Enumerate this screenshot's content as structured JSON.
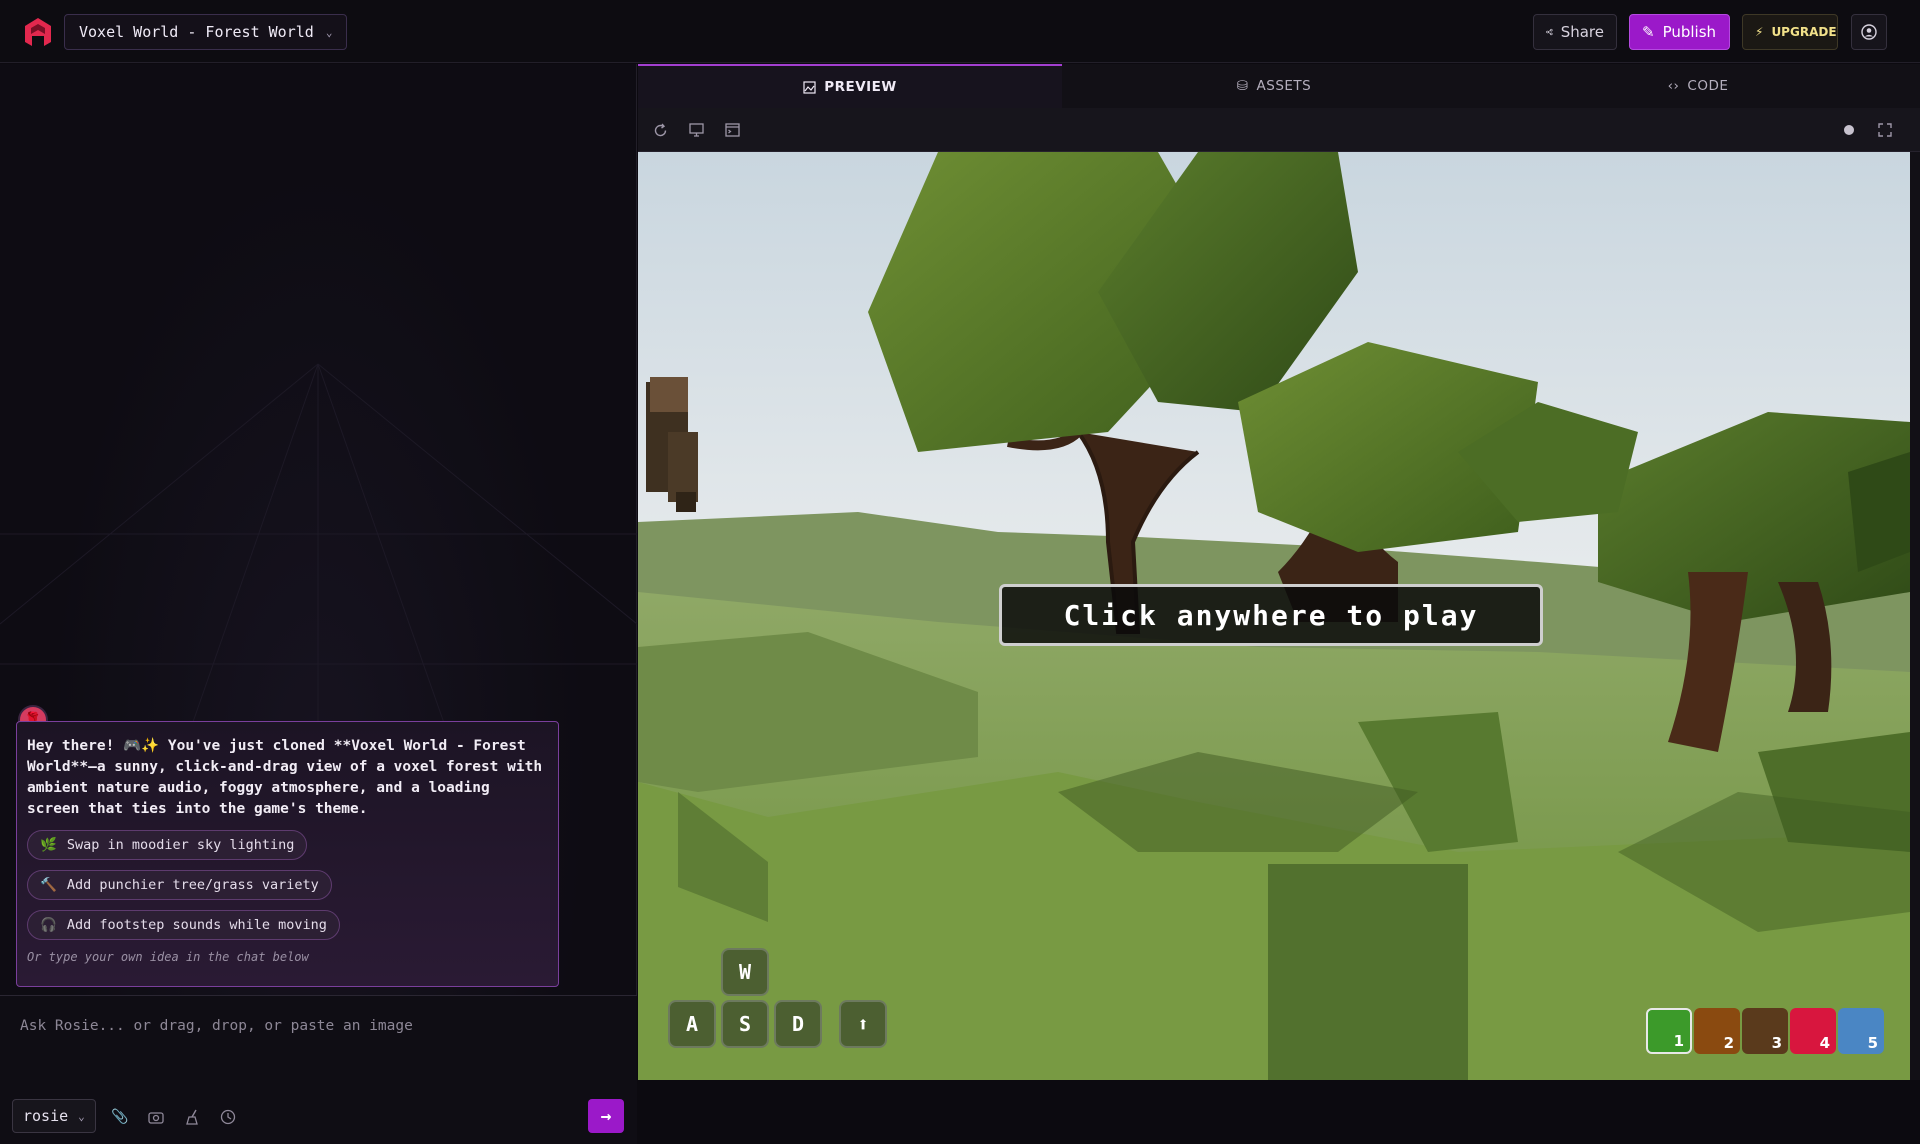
{
  "header": {
    "project_title": "Voxel World - Forest World",
    "share_label": "Share",
    "publish_label": "Publish",
    "upgrade_label": "UPGRADE"
  },
  "chat": {
    "message": "Hey there! 🎮✨ You've just cloned **Voxel World - Forest World**—a sunny, click-and-drag view of a voxel forest with ambient nature audio, foggy atmosphere, and a loading screen that ties into the game's theme.",
    "suggestions": [
      {
        "icon": "🌿",
        "label": "Swap in moodier sky lighting"
      },
      {
        "icon": "🔨",
        "label": "Add punchier tree/grass variety"
      },
      {
        "icon": "🎧",
        "label": "Add footstep sounds while moving"
      }
    ],
    "hint": "Or type your own idea in the chat below",
    "input_placeholder": "Ask Rosie... or drag, drop, or paste an image",
    "model": "rosie"
  },
  "tabs": [
    {
      "label": "PREVIEW"
    },
    {
      "label": "ASSETS"
    },
    {
      "label": "CODE"
    }
  ],
  "game": {
    "overlay_text": "Click anywhere to play",
    "keys": [
      "W",
      "A",
      "S",
      "D",
      "⬆"
    ],
    "hotbar": [
      {
        "num": "1",
        "color": "#3c9a2a"
      },
      {
        "num": "2",
        "color": "#8a4a10"
      },
      {
        "num": "3",
        "color": "#5a3a1c"
      },
      {
        "num": "4",
        "color": "#d8163e"
      },
      {
        "num": "5",
        "color": "#4a86c4"
      }
    ]
  },
  "colors": {
    "accent": "#9b19c9",
    "background": "#0c0a10"
  }
}
